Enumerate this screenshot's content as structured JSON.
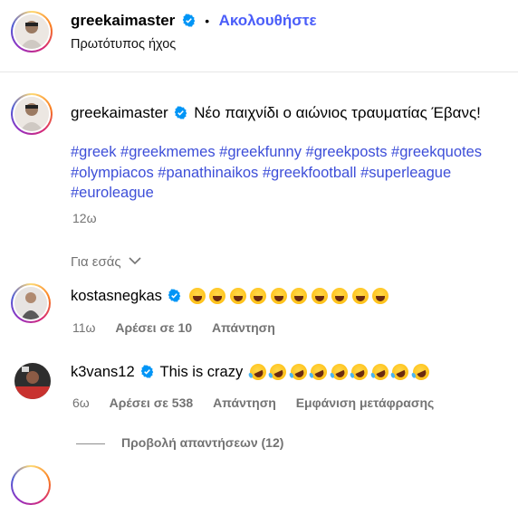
{
  "header": {
    "username": "greekaimaster",
    "dot": "•",
    "follow_label": "Ακολουθήστε",
    "audio": "Πρωτότυπος ήχος"
  },
  "post": {
    "username": "greekaimaster",
    "caption": "Νέο παιχνίδι ο αιώνιος τραυματίας Έβανς!",
    "hashtags": "#greek #greekmemes #greekfunny #greekposts #greekquotes #olympiacos #panathinaikos #greekfootball #superleague #euroleague",
    "time": "12ω"
  },
  "for_you": {
    "label": "Για εσάς"
  },
  "comments": [
    {
      "username": "kostasnegkas",
      "emoji_count": 10,
      "time": "11ω",
      "likes": "Αρέσει σε 10",
      "reply": "Απάντηση"
    },
    {
      "username": "k3vans12",
      "text": "This is crazy",
      "emoji_count": 9,
      "time": "6ω",
      "likes": "Αρέσει σε 538",
      "reply": "Απάντηση",
      "translate": "Εμφάνιση μετάφρασης",
      "view_replies": "Προβολή απαντήσεων (12)"
    }
  ],
  "colors": {
    "link_blue": "#4a5df9",
    "hashtag_blue": "#3d4ed8",
    "verified_blue": "#0095f6",
    "meta_gray": "#737373"
  },
  "icons": [
    "verified-badge-icon",
    "chevron-down-icon"
  ]
}
